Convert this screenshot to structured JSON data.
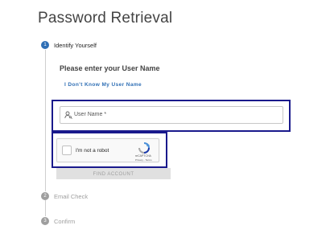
{
  "page": {
    "title": "Password Retrieval"
  },
  "steps": [
    {
      "number": "1",
      "label": "Identify Yourself",
      "state": "active"
    },
    {
      "number": "2",
      "label": "Email Check",
      "state": "inactive"
    },
    {
      "number": "3",
      "label": "Confirm",
      "state": "inactive"
    }
  ],
  "form": {
    "subheading": "Please enter your User Name",
    "forgot_link": "I Don't Know My User Name",
    "username_label": "User Name *",
    "submit_label": "FIND ACCOUNT"
  },
  "captcha": {
    "label": "I'm not a robot",
    "brand": "reCAPTCHA",
    "terms": "Privacy - Terms"
  },
  "colors": {
    "accent": "#2f6fb5",
    "highlight": "#1a1a8c",
    "disabled": "#e0e0e0"
  }
}
